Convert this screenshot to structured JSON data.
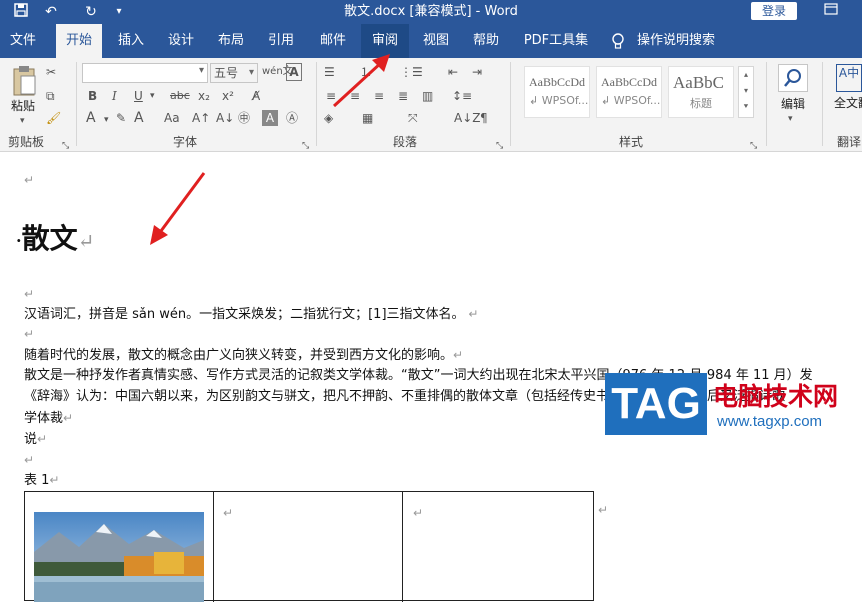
{
  "titlebar": {
    "title": "散文.docx [兼容模式]  -  Word",
    "login_label": "登录"
  },
  "tabs": [
    {
      "label": "文件"
    },
    {
      "label": "开始"
    },
    {
      "label": "插入"
    },
    {
      "label": "设计"
    },
    {
      "label": "布局"
    },
    {
      "label": "引用"
    },
    {
      "label": "邮件"
    },
    {
      "label": "审阅"
    },
    {
      "label": "视图"
    },
    {
      "label": "帮助"
    },
    {
      "label": "PDF工具集"
    },
    {
      "label": "操作说明搜索"
    }
  ],
  "ribbon": {
    "clipboard": {
      "paste_label": "粘贴",
      "group_label": "剪贴板"
    },
    "font": {
      "font_name": "",
      "font_size": "五号",
      "group_label": "字体"
    },
    "paragraph": {
      "group_label": "段落"
    },
    "styles": {
      "items": [
        {
          "preview": "AaBbCcDd",
          "name": "↲ WPSOf..."
        },
        {
          "preview": "AaBbCcDd",
          "name": "↲ WPSOf..."
        },
        {
          "preview": "AaBbC",
          "name": "标题"
        }
      ],
      "group_label": "样式"
    },
    "editing": {
      "label": "编辑"
    },
    "translate": {
      "label": "全文翻译",
      "group_label": "翻译"
    }
  },
  "document": {
    "heading": "散文",
    "lines": [
      "汉语词汇，拼音是 sǎn wén。一指文采焕发；二指犹行文；[1]三指文体名。",
      "随着时代的发展，散文的概念由广义向狭义转变，并受到西方文化的影响。",
      "散文是一种抒发作者真情实感、写作方式灵活的记叙类文学体裁。“散文”一词大约出现在北宋太平兴国（976 年 12 月-984 年 11 月）发",
      "《辞海》认为：中国六朝以来，为区别韵文与骈文，把凡不押韵、不重排偶的散体文章（包括经传史书），统称“散文”。后又泛指诗歌",
      "学体裁",
      "说"
    ],
    "table_caption": "表  1"
  },
  "watermark": {
    "logo": "TAG",
    "site_name": "电脑技术网",
    "url": "www.tagxp.com"
  },
  "colors": {
    "brand": "#2b579a",
    "arrow": "#e02020"
  }
}
